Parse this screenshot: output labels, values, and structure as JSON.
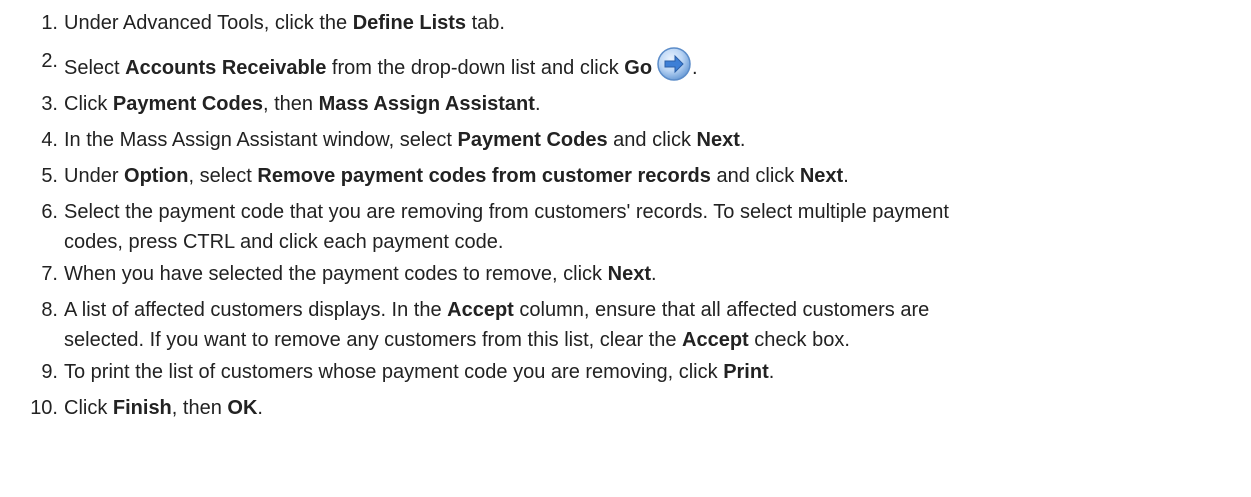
{
  "steps": [
    {
      "n": "1.",
      "a": "Under Advanced Tools, click the ",
      "b": "Define Lists",
      "c": " tab."
    },
    {
      "n": "2.",
      "a": "Select ",
      "b": "Accounts Receivable",
      "c": " from the drop-down list and click ",
      "d": "Go",
      "e": "."
    },
    {
      "n": "3.",
      "a": "Click ",
      "b": "Payment Codes",
      "c": ", then ",
      "d": "Mass Assign Assistant",
      "e": "."
    },
    {
      "n": "4.",
      "a": "In the Mass Assign Assistant window, select ",
      "b": "Payment Codes",
      "c": " and click ",
      "d": "Next",
      "e": "."
    },
    {
      "n": "5.",
      "a": "Under ",
      "b": "Option",
      "c": ", select ",
      "d": "Remove payment codes from customer records",
      "e": " and click ",
      "f": "Next",
      "g": "."
    },
    {
      "n": "6.",
      "line1": "Select the payment code that you are removing from customers' records. To select multiple payment",
      "line2": "codes, press CTRL and click each payment code."
    },
    {
      "n": "7.",
      "a": "When you have selected the payment codes to remove, click ",
      "b": "Next",
      "c": "."
    },
    {
      "n": "8.",
      "a": "A list of affected customers displays. In the ",
      "b": "Accept",
      "c": " column, ensure that all affected customers are",
      "d": "selected. If you want to remove any customers from this list, clear the ",
      "e": "Accept",
      "f": " check box."
    },
    {
      "n": "9.",
      "a": "To print the list of customers whose payment code you are removing, click ",
      "b": "Print",
      "c": "."
    },
    {
      "n": "10.",
      "a": "Click ",
      "b": "Finish",
      "c": ", then ",
      "d": "OK",
      "e": "."
    }
  ],
  "icons": {
    "go": "go-arrow-icon",
    "go_color": "#3d7fd6"
  }
}
